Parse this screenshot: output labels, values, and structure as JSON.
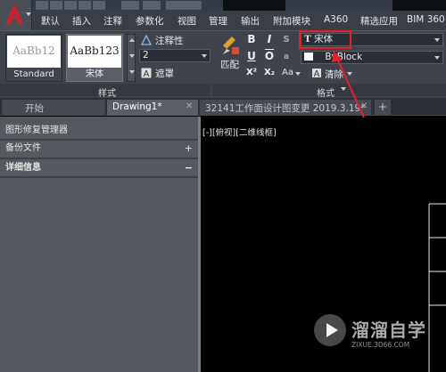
{
  "ribbon_tabs": [
    "默认",
    "插入",
    "注释",
    "参数化",
    "视图",
    "管理",
    "输出",
    "附加模块",
    "A360",
    "精选应用",
    "BIM 360"
  ],
  "style_group": {
    "cards": [
      {
        "preview": "AaBb12",
        "caption": "Standard"
      },
      {
        "preview": "AaBb123",
        "caption": "宋体"
      }
    ],
    "title": "样式"
  },
  "annot_group": {
    "annotative_label": "注释性",
    "height_value": "2",
    "mask_label": "遮罩"
  },
  "format_group": {
    "match_label": "匹配",
    "font_dropdown": "宋体",
    "color_dropdown": "ByBlock",
    "clear_label": "清除",
    "title": "格式",
    "case_label": "Aa"
  },
  "doc_tabs": {
    "start": "开始",
    "drawing1": "Drawing1*",
    "drawing2": "32141工作面设计图变更  2019.3.19*",
    "add": "+"
  },
  "palette": {
    "title": "图形修复管理器",
    "backup_label": "备份文件",
    "details_label": "详细信息"
  },
  "viewport_label": "[-][俯视][二维线框]",
  "watermark": {
    "brand": "溜溜自学",
    "url": "ZIXUE.3D66.COM"
  },
  "accent_color": "#e8202a"
}
